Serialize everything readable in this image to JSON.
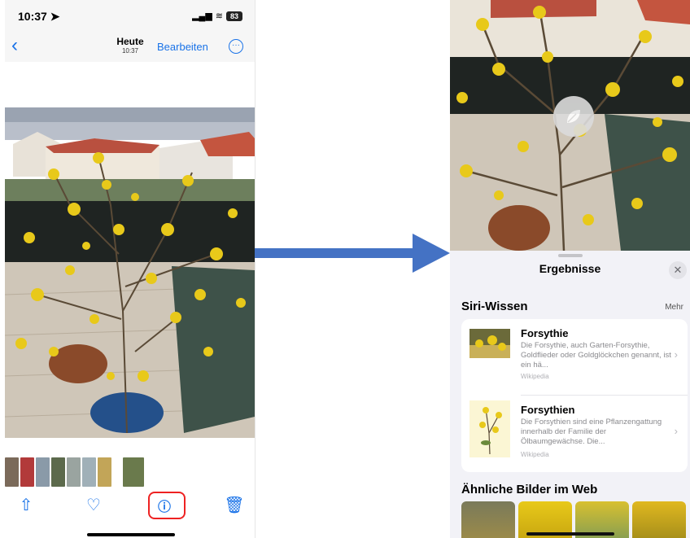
{
  "left": {
    "status": {
      "time": "10:37",
      "battery": "83"
    },
    "nav": {
      "title": "Heute",
      "subtitle": "10:37",
      "edit_label": "Bearbeiten"
    }
  },
  "right": {
    "sheet": {
      "title": "Ergebnisse",
      "siri_section": "Siri-Wissen",
      "more_label": "Mehr",
      "results": [
        {
          "name": "Forsythie",
          "description": "Die Forsythie, auch Garten-Forsythie, Goldflieder oder Goldglöckchen genannt, ist ein hä...",
          "source": "Wikipedia"
        },
        {
          "name": "Forsythien",
          "description": "Die Forsythien sind eine Pflanzengattung innerhalb der Familie der Ölbaumgewächse. Die...",
          "source": "Wikipedia"
        }
      ],
      "web_section": "Ähnliche Bilder im Web"
    }
  },
  "icons": [
    "location-arrow-icon",
    "signal-icon",
    "wifi-icon",
    "battery-icon",
    "back-chevron-icon",
    "ellipsis-icon",
    "share-icon",
    "heart-icon",
    "visual-lookup-icon",
    "trash-icon",
    "arrow-icon",
    "leaf-icon",
    "close-icon",
    "chevron-right-icon"
  ],
  "colors": {
    "accent": "#1a73e8",
    "highlight": "#e22222",
    "arrow": "#4472c4",
    "flower": "#e8c91a"
  }
}
